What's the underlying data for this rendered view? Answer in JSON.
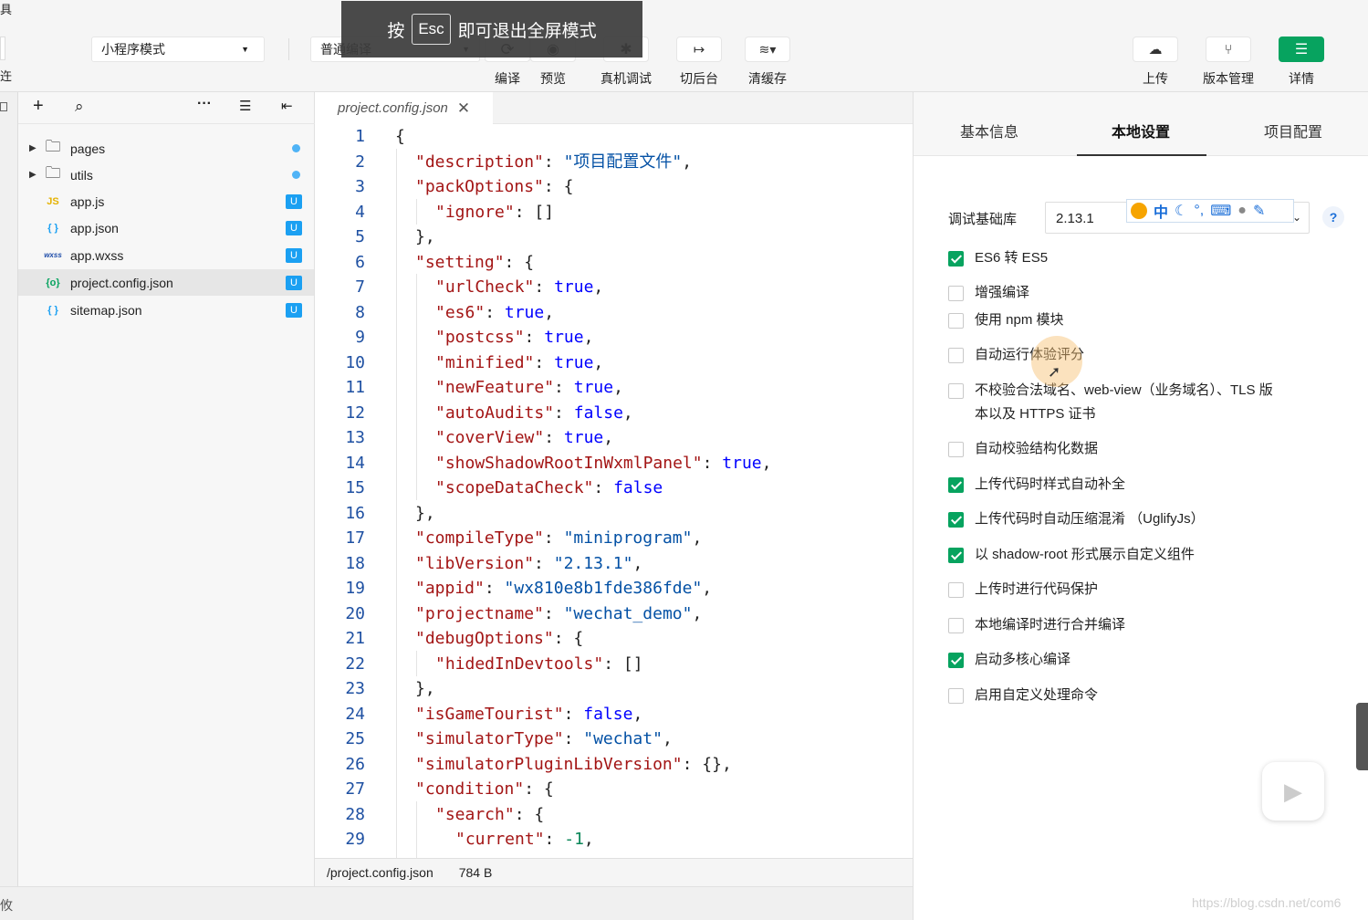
{
  "overlay": {
    "pre": "按",
    "key": "Esc",
    "post": "即可退出全屏模式"
  },
  "toolbar": {
    "mode_select": "小程序模式",
    "compile_select": "普通编译",
    "compile": "编译",
    "preview": "预览",
    "device_debug": "真机调试",
    "background": "切后台",
    "clear_cache": "清缓存",
    "upload": "上传",
    "version": "版本管理",
    "details": "详情",
    "left_edge_text": "具",
    "left_edge_text2": "迕"
  },
  "explorer": {
    "items": [
      {
        "label": "pages",
        "type": "folder",
        "badge": "dot"
      },
      {
        "label": "utils",
        "type": "folder",
        "badge": "dot"
      },
      {
        "label": "app.js",
        "type": "js",
        "badge": "U"
      },
      {
        "label": "app.json",
        "type": "json",
        "badge": "U"
      },
      {
        "label": "app.wxss",
        "type": "wxss",
        "badge": "U"
      },
      {
        "label": "project.config.json",
        "type": "config",
        "badge": "U",
        "selected": true
      },
      {
        "label": "sitemap.json",
        "type": "json",
        "badge": "U"
      }
    ],
    "icons": {
      "js": "JS",
      "json": "{ }",
      "wxss": "wxss",
      "config": "{o}"
    }
  },
  "editor": {
    "tab": "project.config.json",
    "status_path": "/project.config.json",
    "status_size": "784 B",
    "lines": [
      {
        "n": "1",
        "i": 0,
        "t": [
          [
            "p",
            "{"
          ]
        ]
      },
      {
        "n": "2",
        "i": 1,
        "t": [
          [
            "k",
            "\"description\""
          ],
          [
            "p",
            ": "
          ],
          [
            "s",
            "\"项目配置文件\""
          ],
          [
            "p",
            ","
          ]
        ]
      },
      {
        "n": "3",
        "i": 1,
        "t": [
          [
            "k",
            "\"packOptions\""
          ],
          [
            "p",
            ": {"
          ]
        ]
      },
      {
        "n": "4",
        "i": 2,
        "t": [
          [
            "k",
            "\"ignore\""
          ],
          [
            "p",
            ": []"
          ]
        ]
      },
      {
        "n": "5",
        "i": 1,
        "t": [
          [
            "p",
            "},"
          ]
        ]
      },
      {
        "n": "6",
        "i": 1,
        "t": [
          [
            "k",
            "\"setting\""
          ],
          [
            "p",
            ": {"
          ]
        ]
      },
      {
        "n": "7",
        "i": 2,
        "t": [
          [
            "k",
            "\"urlCheck\""
          ],
          [
            "p",
            ": "
          ],
          [
            "b",
            "true"
          ],
          [
            "p",
            ","
          ]
        ]
      },
      {
        "n": "8",
        "i": 2,
        "t": [
          [
            "k",
            "\"es6\""
          ],
          [
            "p",
            ": "
          ],
          [
            "b",
            "true"
          ],
          [
            "p",
            ","
          ]
        ]
      },
      {
        "n": "9",
        "i": 2,
        "t": [
          [
            "k",
            "\"postcss\""
          ],
          [
            "p",
            ": "
          ],
          [
            "b",
            "true"
          ],
          [
            "p",
            ","
          ]
        ]
      },
      {
        "n": "10",
        "i": 2,
        "t": [
          [
            "k",
            "\"minified\""
          ],
          [
            "p",
            ": "
          ],
          [
            "b",
            "true"
          ],
          [
            "p",
            ","
          ]
        ]
      },
      {
        "n": "11",
        "i": 2,
        "t": [
          [
            "k",
            "\"newFeature\""
          ],
          [
            "p",
            ": "
          ],
          [
            "b",
            "true"
          ],
          [
            "p",
            ","
          ]
        ]
      },
      {
        "n": "12",
        "i": 2,
        "t": [
          [
            "k",
            "\"autoAudits\""
          ],
          [
            "p",
            ": "
          ],
          [
            "b",
            "false"
          ],
          [
            "p",
            ","
          ]
        ]
      },
      {
        "n": "13",
        "i": 2,
        "t": [
          [
            "k",
            "\"coverView\""
          ],
          [
            "p",
            ": "
          ],
          [
            "b",
            "true"
          ],
          [
            "p",
            ","
          ]
        ]
      },
      {
        "n": "14",
        "i": 2,
        "t": [
          [
            "k",
            "\"showShadowRootInWxmlPanel\""
          ],
          [
            "p",
            ": "
          ],
          [
            "b",
            "true"
          ],
          [
            "p",
            ","
          ]
        ]
      },
      {
        "n": "15",
        "i": 2,
        "t": [
          [
            "k",
            "\"scopeDataCheck\""
          ],
          [
            "p",
            ": "
          ],
          [
            "b",
            "false"
          ]
        ]
      },
      {
        "n": "16",
        "i": 1,
        "t": [
          [
            "p",
            "},"
          ]
        ]
      },
      {
        "n": "17",
        "i": 1,
        "t": [
          [
            "k",
            "\"compileType\""
          ],
          [
            "p",
            ": "
          ],
          [
            "s",
            "\"miniprogram\""
          ],
          [
            "p",
            ","
          ]
        ]
      },
      {
        "n": "18",
        "i": 1,
        "t": [
          [
            "k",
            "\"libVersion\""
          ],
          [
            "p",
            ": "
          ],
          [
            "s",
            "\"2.13.1\""
          ],
          [
            "p",
            ","
          ]
        ]
      },
      {
        "n": "19",
        "i": 1,
        "t": [
          [
            "k",
            "\"appid\""
          ],
          [
            "p",
            ": "
          ],
          [
            "s",
            "\"wx810e8b1fde386fde\""
          ],
          [
            "p",
            ","
          ]
        ]
      },
      {
        "n": "20",
        "i": 1,
        "t": [
          [
            "k",
            "\"projectname\""
          ],
          [
            "p",
            ": "
          ],
          [
            "s",
            "\"wechat_demo\""
          ],
          [
            "p",
            ","
          ]
        ]
      },
      {
        "n": "21",
        "i": 1,
        "t": [
          [
            "k",
            "\"debugOptions\""
          ],
          [
            "p",
            ": {"
          ]
        ]
      },
      {
        "n": "22",
        "i": 2,
        "t": [
          [
            "k",
            "\"hidedInDevtools\""
          ],
          [
            "p",
            ": []"
          ]
        ]
      },
      {
        "n": "23",
        "i": 1,
        "t": [
          [
            "p",
            "},"
          ]
        ]
      },
      {
        "n": "24",
        "i": 1,
        "t": [
          [
            "k",
            "\"isGameTourist\""
          ],
          [
            "p",
            ": "
          ],
          [
            "b",
            "false"
          ],
          [
            "p",
            ","
          ]
        ]
      },
      {
        "n": "25",
        "i": 1,
        "t": [
          [
            "k",
            "\"simulatorType\""
          ],
          [
            "p",
            ": "
          ],
          [
            "s",
            "\"wechat\""
          ],
          [
            "p",
            ","
          ]
        ]
      },
      {
        "n": "26",
        "i": 1,
        "t": [
          [
            "k",
            "\"simulatorPluginLibVersion\""
          ],
          [
            "p",
            ": {},"
          ]
        ]
      },
      {
        "n": "27",
        "i": 1,
        "t": [
          [
            "k",
            "\"condition\""
          ],
          [
            "p",
            ": {"
          ]
        ]
      },
      {
        "n": "28",
        "i": 2,
        "t": [
          [
            "k",
            "\"search\""
          ],
          [
            "p",
            ": {"
          ]
        ]
      },
      {
        "n": "29",
        "i": 3,
        "t": [
          [
            "k",
            "\"current\""
          ],
          [
            "p",
            ": "
          ],
          [
            "n",
            "-1"
          ],
          [
            "p",
            ","
          ]
        ]
      }
    ]
  },
  "settings": {
    "tabs": [
      "基本信息",
      "本地设置",
      "项目配置"
    ],
    "active_tab": 1,
    "lib_label": "调试基础库",
    "lib_value": "2.13.1",
    "help": "?",
    "options": [
      {
        "label": "ES6 转 ES5",
        "checked": true
      },
      {
        "label": "增强编译",
        "checked": false
      },
      {
        "label": "使用 npm 模块",
        "checked": false
      },
      {
        "label": "自动运行体验评分",
        "checked": false
      },
      {
        "label": "不校验合法域名、web-view（业务域名）、TLS 版",
        "label2": "本以及 HTTPS 证书",
        "checked": false
      },
      {
        "label": "自动校验结构化数据",
        "checked": false
      },
      {
        "label": "上传代码时样式自动补全",
        "checked": true
      },
      {
        "label": "上传代码时自动压缩混淆 （UglifyJs）",
        "checked": true
      },
      {
        "label": "以 shadow-root 形式展示自定义组件",
        "checked": true
      },
      {
        "label": "上传时进行代码保护",
        "checked": false
      },
      {
        "label": "本地编译时进行合并编译",
        "checked": false
      },
      {
        "label": "启动多核心编译",
        "checked": true
      },
      {
        "label": "启用自定义处理命令",
        "checked": false
      }
    ]
  },
  "ime": {
    "zh": "中"
  },
  "watermark": "https://blog.csdn.net/com6",
  "bottom_left": "攸",
  "colors": {
    "accent": "#07a35f",
    "badge": "#1ba0f2"
  }
}
